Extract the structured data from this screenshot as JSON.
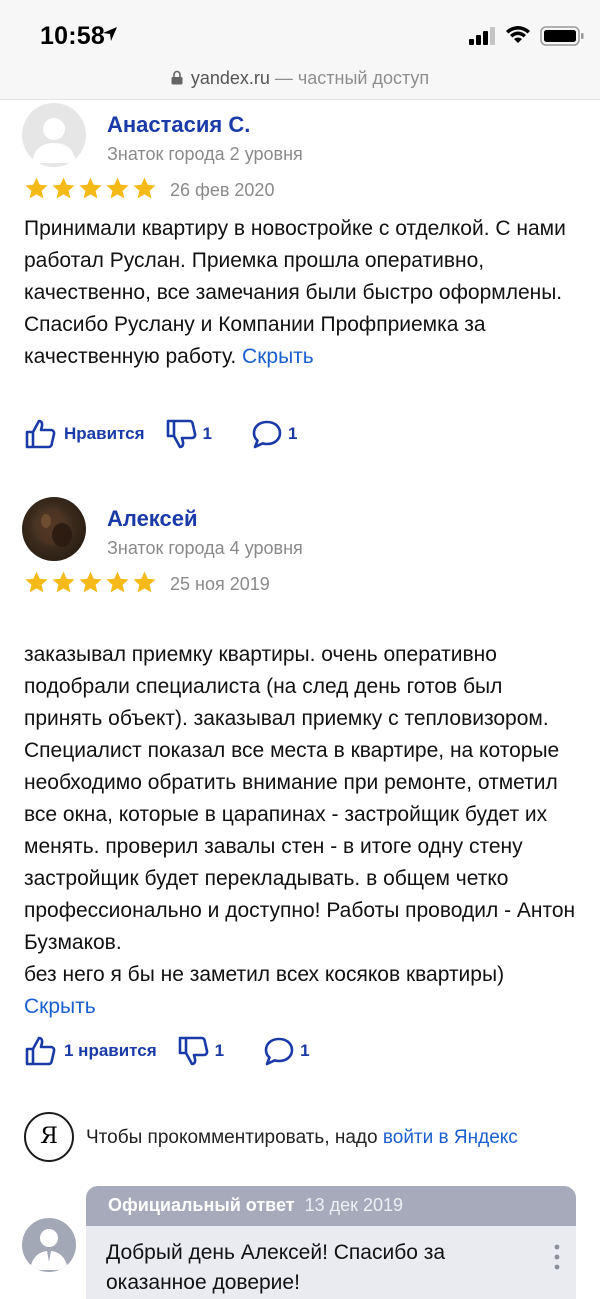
{
  "status": {
    "time": "10:58"
  },
  "urlbar": {
    "host": "yandex.ru",
    "suffix": " — частный доступ"
  },
  "reviews": [
    {
      "name": "Анастасия С.",
      "rank": "Знаток города 2 уровня",
      "rating": 5,
      "date": "26 фев 2020",
      "text": "Принимали квартиру в новостройке с отделкой. С нами работал Руслан. Приемка прошла оперативно, качественно, все замечания были быстро оформлены. Спасибо Руслану и Компании Профприемка за качественную работу.",
      "hide_label": "Скрыть",
      "likes_label": "Нравится",
      "dislikes": "1",
      "comments": "1"
    },
    {
      "name": "Алексей",
      "rank": "Знаток города 4 уровня",
      "rating": 5,
      "date": "25 ноя 2019",
      "text": "заказывал приемку квартиры. очень оперативно подобрали специалиста (на след день готов был принять объект). заказывал приемку с тепловизором. Специалист показал все места в квартире, на которые необходимо обратить внимание при ремонте, отметил все окна, которые в царапинах - застройщик будет их менять. проверил завалы стен - в итоге одну стену застройщик будет перекладывать. в общем четко профессионально и доступно! Работы проводил - Антон Бузмаков.\nбез него я бы не заметил всех косяков квартиры)",
      "hide_label": "Скрыть",
      "likes_label": "1 нравится",
      "dislikes": "1",
      "comments": "1"
    }
  ],
  "comment_prompt": {
    "logo": "Я",
    "text": "Чтобы прокомментировать, надо ",
    "link": "войти в Яндекс"
  },
  "official_reply": {
    "title": "Официальный ответ",
    "date": "13 дек 2019",
    "text": "Добрый день Алексей! Спасибо за оказанное доверие!"
  },
  "colors": {
    "accent": "#1a3aa8",
    "link": "#1a5fd0",
    "star": "#f5b918"
  }
}
